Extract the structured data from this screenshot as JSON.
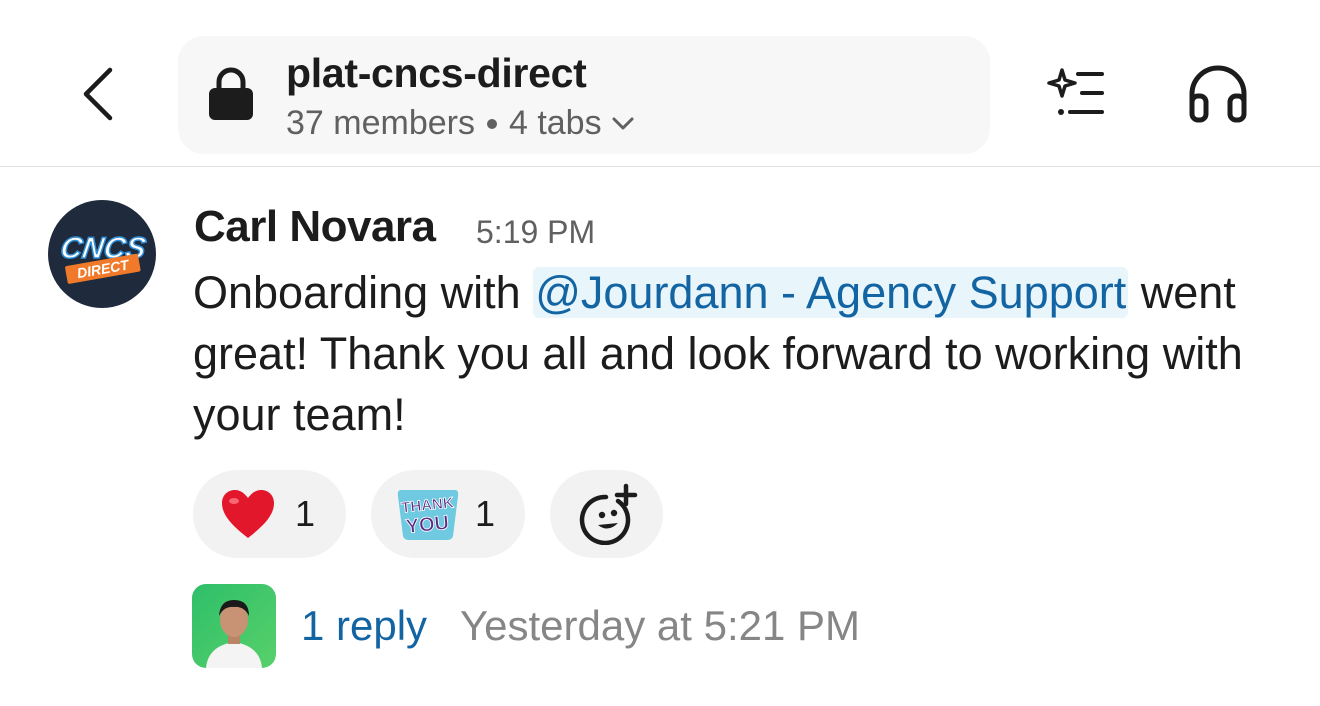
{
  "header": {
    "channel_name": "plat-cncs-direct",
    "members": "37 members",
    "tabs": "4 tabs"
  },
  "message": {
    "author": "Carl Novara",
    "time": "5:19 PM",
    "text_before": "Onboarding with ",
    "mention": "@Jourdann - Agency Support",
    "text_after": " went great!  Thank you all and look forward to working with your team!",
    "avatar_logo_top": "CNCS",
    "avatar_logo_bottom": "DIRECT"
  },
  "reactions": [
    {
      "emoji": "heart",
      "count": "1"
    },
    {
      "emoji": "thank-you",
      "count": "1",
      "sticker_text_1": "THANK",
      "sticker_text_2": "YOU"
    }
  ],
  "thread": {
    "reply_count": "1 reply",
    "last_reply": "Yesterday at 5:21 PM"
  },
  "colors": {
    "link": "#1264a3",
    "mention_bg": "#e8f5fa",
    "reaction_bg": "#f2f2f2",
    "pill_bg": "#f7f7f7",
    "avatar_bg": "#1f2a3c"
  }
}
